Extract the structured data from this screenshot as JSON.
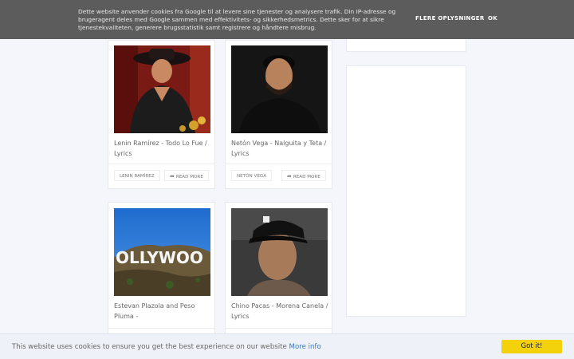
{
  "cookie_banner": {
    "message": "Dette website anvender cookies fra Google til at levere sine tjenester og analysere trafik. Din IP-adresse og brugeragent deles med Google sammen med effektivitets- og sikkerhedsmetrics. Dette sker for at sikre tjenestekvaliteten, generere brugsstatistik samt registrere og håndtere misbrug.",
    "more_label": "FLERE OPLYSNINGER",
    "ok_label": "OK"
  },
  "posts": [
    {
      "title": "Lenin Ramírez - Todo Lo Fue / Lyrics",
      "label": "LENIN RAMÍREZ",
      "read_more": "READ MORE",
      "image": "man-in-cowboy-hat-photo"
    },
    {
      "title": "Netón Vega - Nalguita y Teta / Lyrics",
      "label": "NETÓN VEGA",
      "read_more": "READ MORE",
      "image": "man-portrait-photo"
    },
    {
      "title": "Estevan Plazola and Peso Pluma -",
      "label": "",
      "read_more": "",
      "image": "hollywood-sign-photo"
    },
    {
      "title": "Chino Pacas - Morena Canela / Lyrics",
      "label": "",
      "read_more": "",
      "image": "man-in-cap-photo"
    }
  ],
  "cookie_bar": {
    "message": "This website uses cookies to ensure you get the best experience on our website",
    "more_info": "More info",
    "got_it": "Got it!"
  },
  "colors": {
    "banner_bg": "#5c5c5c",
    "gotit_bg": "#f4d20b",
    "link": "#3a76c4"
  }
}
